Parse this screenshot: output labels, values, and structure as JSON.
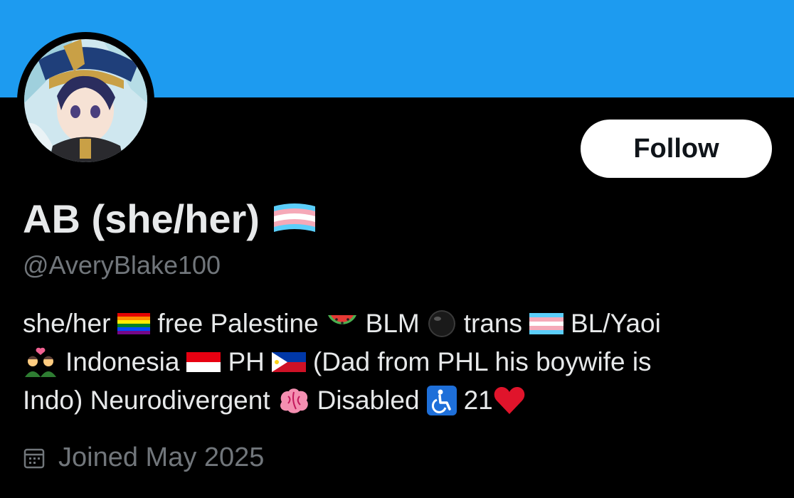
{
  "colors": {
    "banner": "#1d9bf0",
    "background": "#000000",
    "primary_text": "#e7e9ea",
    "secondary_text": "#71767b",
    "follow_button_bg": "#ffffff",
    "follow_button_text": "#0f1419"
  },
  "profile": {
    "follow_label": "Follow",
    "display_name": "AB (she/her)",
    "display_name_icon": "trans-flag-icon",
    "handle": "@AveryBlake100",
    "bio": {
      "line1": [
        "she/her",
        "free Palestine",
        "BLM",
        "trans",
        "BL/Yaoi"
      ],
      "line2": [
        "Indonesia",
        "PH",
        "(Dad from PHL his boywife is"
      ],
      "line3": [
        "Indo) Neurodivergent",
        "Disabled",
        "21"
      ]
    },
    "joined": "Joined May 2025",
    "joined_icon": "calendar-icon"
  }
}
